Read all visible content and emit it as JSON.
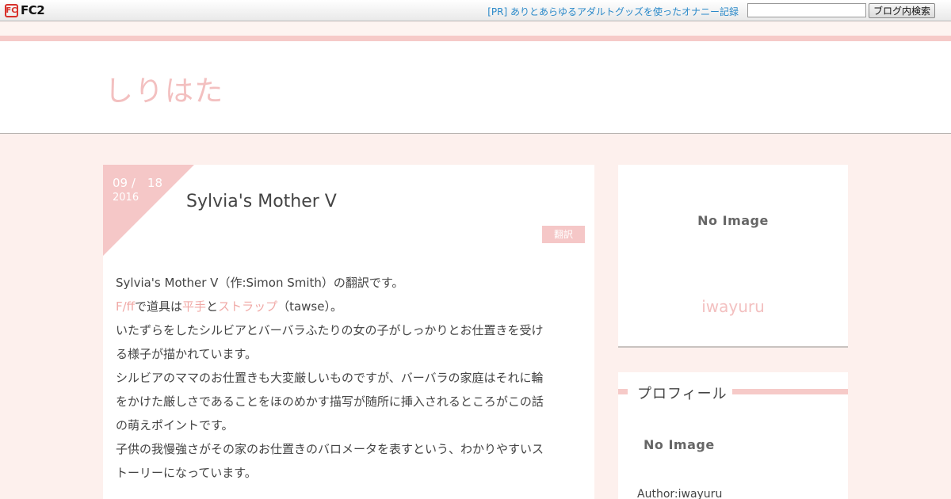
{
  "fc2bar": {
    "logo_mark": "FC",
    "logo_text": "FC2",
    "pr_link": "[PR] ありとあらゆるアダルトグッズを使ったオナニー記録",
    "search_value": "",
    "search_button": "ブログ内検索"
  },
  "blog": {
    "title": "しりはた"
  },
  "article": {
    "date_md": "09 /　18",
    "date_year": "2016",
    "title": "Sylvia's Mother Ⅴ",
    "category": "翻訳",
    "intro": "Sylvia's Mother Ⅴ（作:Simon Smith）の翻訳です。",
    "tag1": "F/ff",
    "tag1_suffix": "で道具は",
    "tag2": "平手",
    "tag_join": "と",
    "tag3": "ストラップ",
    "tag3_suffix": "（tawse）。",
    "lines": [
      "いたずらをしたシルビアとバーバラふたりの女の子がしっかりとお仕置きを受け",
      "る様子が描かれています。",
      "シルビアのママのお仕置きも大変厳しいものですが、バーバラの家庭はそれに輪",
      "をかけた厳しさであることをほのめかす描写が随所に挿入されるところがこの話",
      "の萌えポイントです。",
      "子供の我慢強さがその家のお仕置きのバロメータを表すという、わかりやすいス",
      "トーリーになっています。"
    ]
  },
  "sidebar": {
    "image_placeholder": "No Image",
    "user_name": "iwayuru",
    "profile_heading": "プロフィール",
    "profile_image_placeholder": "No Image",
    "author": "Author:iwayuru"
  },
  "colors": {
    "accent": "#f5c7c7",
    "link": "#f0a9a6",
    "fc2_link": "#2a89c9"
  }
}
